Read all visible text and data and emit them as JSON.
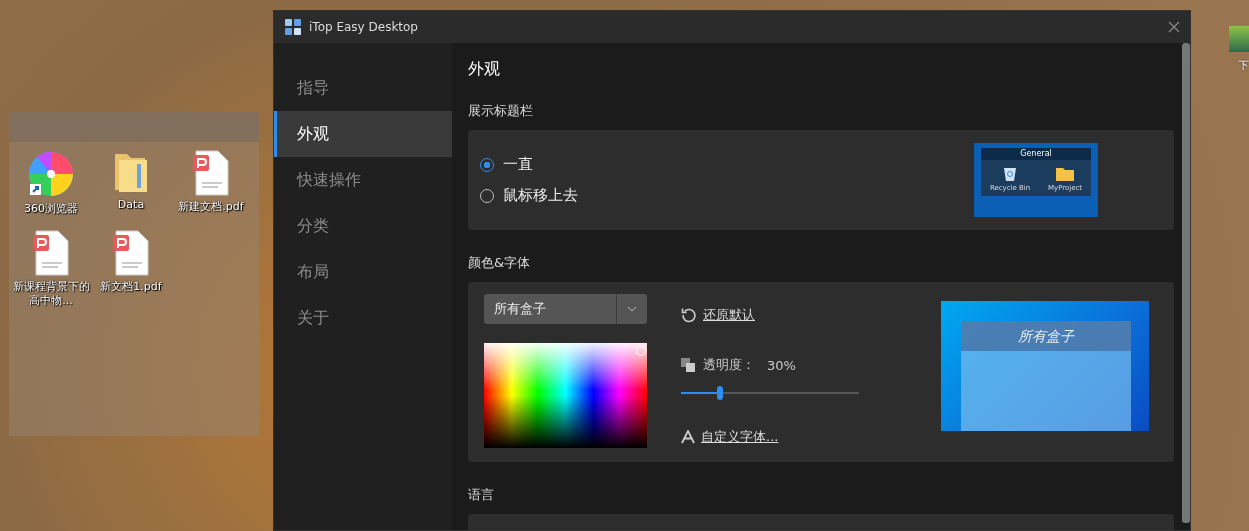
{
  "desktop": {
    "fence_icons": [
      {
        "label": "360浏览器",
        "kind": "app"
      },
      {
        "label": "Data",
        "kind": "folder"
      },
      {
        "label": "新建文档.pdf",
        "kind": "pdf"
      },
      {
        "label": "新课程背景下的高中物...",
        "kind": "pdf"
      },
      {
        "label": "新文档1.pdf",
        "kind": "pdf"
      }
    ],
    "edge_icon": {
      "label": "下"
    }
  },
  "window": {
    "title": "iTop Easy Desktop"
  },
  "sidebar": {
    "items": [
      {
        "label": "指导",
        "selected": false
      },
      {
        "label": "外观",
        "selected": true
      },
      {
        "label": "快速操作",
        "selected": false
      },
      {
        "label": "分类",
        "selected": false
      },
      {
        "label": "布局",
        "selected": false
      },
      {
        "label": "关于",
        "selected": false
      }
    ]
  },
  "page_title": "外观",
  "title_bar_section": {
    "heading": "展示标题栏",
    "options": [
      {
        "label": "一直",
        "selected": true
      },
      {
        "label": "鼠标移上去",
        "selected": false
      }
    ],
    "preview": {
      "header": "General",
      "icons": [
        {
          "label": "Recycle Bin",
          "kind": "bin"
        },
        {
          "label": "MyProject",
          "kind": "folder"
        }
      ]
    }
  },
  "color_font_section": {
    "heading": "颜色&字体",
    "box_select": {
      "value": "所有盒子"
    },
    "restore_link": "还原默认",
    "opacity": {
      "label": "透明度：",
      "reading": "30%",
      "level": 0.22
    },
    "font_link": "自定义字体...",
    "preview": {
      "label": "所有盒子"
    }
  },
  "language_section": {
    "heading": "语言"
  }
}
